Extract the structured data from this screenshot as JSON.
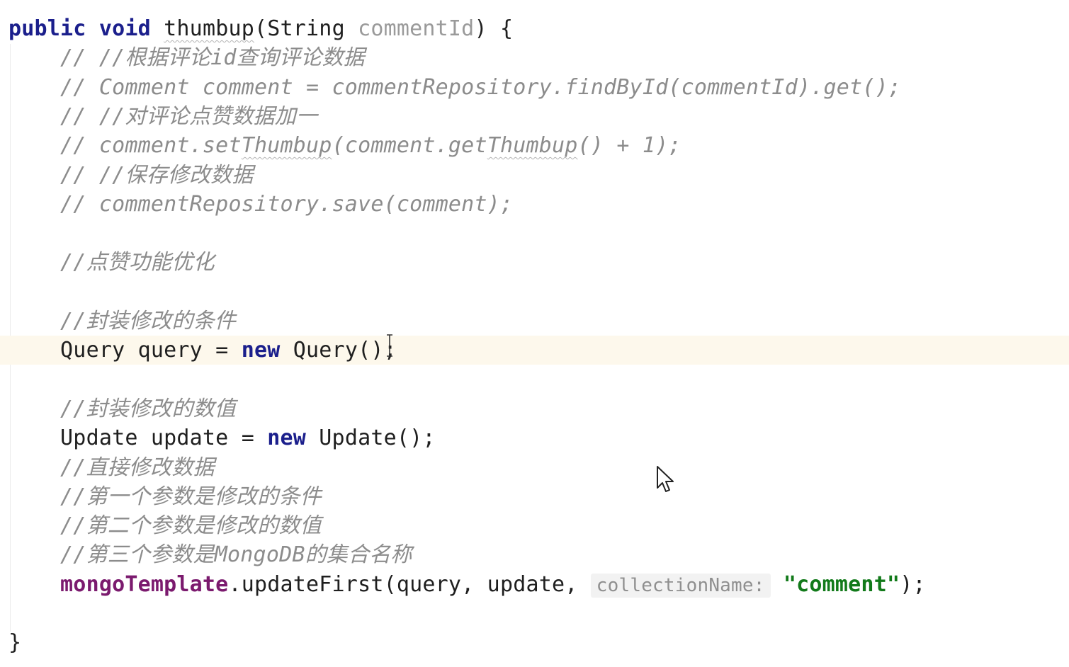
{
  "editor": {
    "lines": [
      {
        "tokens": [
          {
            "t": "public",
            "s": "kw"
          },
          {
            "t": " ",
            "s": "plain"
          },
          {
            "t": "void",
            "s": "kw"
          },
          {
            "t": " ",
            "s": "plain"
          },
          {
            "t": "thumbup",
            "s": "plain squiggle"
          },
          {
            "t": "(String ",
            "s": "plain"
          },
          {
            "t": "commentId",
            "s": "param-dim"
          },
          {
            "t": ") {",
            "s": "plain"
          }
        ]
      },
      {
        "tokens": [
          {
            "t": "    // //根据评论id查询评论数据",
            "s": "comment"
          }
        ]
      },
      {
        "tokens": [
          {
            "t": "    // Comment comment = commentRepository.findById(commentId).get();",
            "s": "comment"
          }
        ]
      },
      {
        "tokens": [
          {
            "t": "    // //对评论点赞数据加一",
            "s": "comment"
          }
        ]
      },
      {
        "tokens": [
          {
            "t": "    // comment.set",
            "s": "comment"
          },
          {
            "t": "Thumbup",
            "s": "comment squiggle"
          },
          {
            "t": "(comment.get",
            "s": "comment"
          },
          {
            "t": "Thumbup",
            "s": "comment squiggle"
          },
          {
            "t": "() + 1);",
            "s": "comment"
          }
        ]
      },
      {
        "tokens": [
          {
            "t": "    // //保存修改数据",
            "s": "comment"
          }
        ]
      },
      {
        "tokens": [
          {
            "t": "    // commentRepository.save(comment);",
            "s": "comment"
          }
        ]
      },
      {
        "tokens": []
      },
      {
        "tokens": [
          {
            "t": "    //点赞功能优化",
            "s": "comment"
          }
        ]
      },
      {
        "tokens": []
      },
      {
        "tokens": [
          {
            "t": "    //封装修改的条件",
            "s": "comment"
          }
        ]
      },
      {
        "current": true,
        "tokens": [
          {
            "t": "    Query query = ",
            "s": "plain"
          },
          {
            "t": "new",
            "s": "kw"
          },
          {
            "t": " Query();",
            "s": "plain"
          }
        ]
      },
      {
        "tokens": []
      },
      {
        "tokens": [
          {
            "t": "    //封装修改的数值",
            "s": "comment"
          }
        ]
      },
      {
        "tokens": [
          {
            "t": "    Update update = ",
            "s": "plain"
          },
          {
            "t": "new",
            "s": "kw"
          },
          {
            "t": " Update();",
            "s": "plain"
          }
        ]
      },
      {
        "tokens": [
          {
            "t": "    //直接修改数据",
            "s": "comment"
          }
        ]
      },
      {
        "tokens": [
          {
            "t": "    //第一个参数是修改的条件",
            "s": "comment"
          }
        ]
      },
      {
        "tokens": [
          {
            "t": "    //第二个参数是修改的数值",
            "s": "comment"
          }
        ]
      },
      {
        "tokens": [
          {
            "t": "    //第三个参数是MongoDB的集合名称",
            "s": "comment"
          }
        ]
      },
      {
        "tokens": [
          {
            "t": "    ",
            "s": "plain"
          },
          {
            "t": "mongoTemplate",
            "s": "field"
          },
          {
            "t": ".updateFirst(query, update, ",
            "s": "plain"
          },
          {
            "t": "collectionName:",
            "s": "hint"
          },
          {
            "t": " ",
            "s": "plain"
          },
          {
            "t": "\"comment\"",
            "s": "string"
          },
          {
            "t": ");",
            "s": "plain"
          }
        ]
      },
      {
        "tokens": []
      },
      {
        "tokens": [
          {
            "t": "}",
            "s": "plain"
          }
        ]
      }
    ]
  }
}
